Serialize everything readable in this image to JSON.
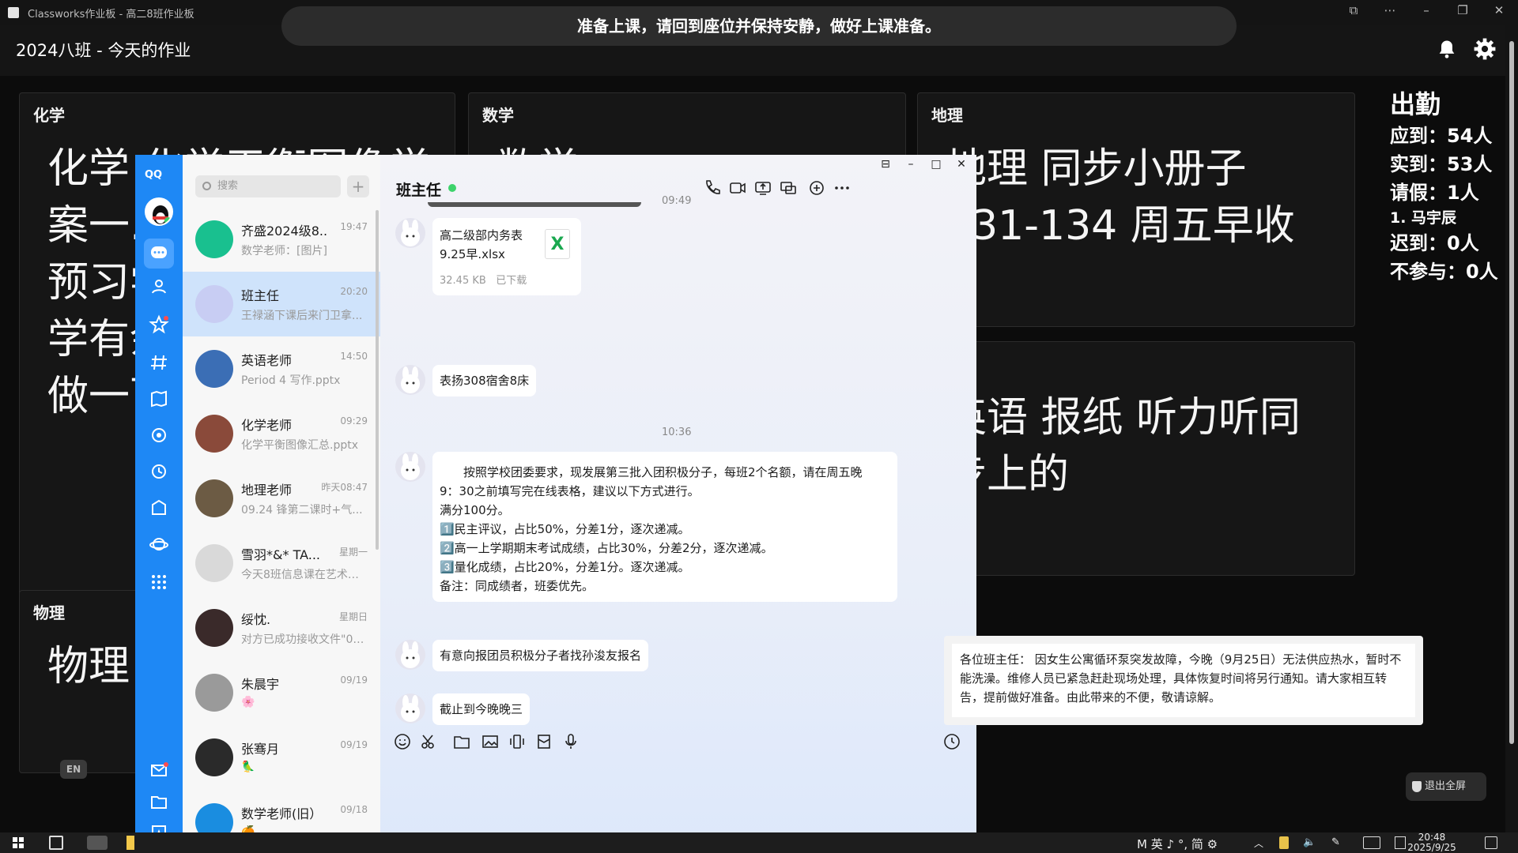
{
  "window": {
    "title": "Classworks作业板 - 高二8班作业板"
  },
  "banner": {
    "text": "准备上课，请回到座位并保持安静，做好上课准备。"
  },
  "header": {
    "title": "2024八班 - 今天的作业"
  },
  "cards": [
    {
      "subject": "化学",
      "lines": [
        "化学 化学平衡图像学",
        "案一...",
        "预习学",
        "学有余",
        "做一下"
      ]
    },
    {
      "subject": "数学",
      "lines": [
        "数学 ..."
      ]
    },
    {
      "subject": "地理",
      "lines": [
        "地理 同步小册子",
        "131-134 周五早收"
      ]
    },
    {
      "subject": "",
      "lines": [
        "英语 报纸 听力听同",
        "步上的"
      ]
    },
    {
      "subject": "物理",
      "lines": [
        "物理"
      ]
    }
  ],
  "attendance": {
    "title": "出勤",
    "due": "应到：54人",
    "present": "实到：53人",
    "leave": "请假：1人",
    "leave_name": "1. 马宇辰",
    "late": "迟到：0人",
    "absent": "不参与：0人"
  },
  "notice": {
    "text": "各位班主任： 因女生公寓循环泵突发故障，今晚（9月25日）无法供应热水，暂时不能洗澡。维修人员已紧急赶赴现场处理，具体恢复时间将另行通知。请大家相互转告，提前做好准备。由此带来的不便，敬请谅解。"
  },
  "exit_fullscreen": {
    "label": "退出全屏"
  },
  "en_badge": "EN",
  "qq": {
    "brand": "QQ",
    "search_placeholder": "搜索",
    "add": "+",
    "conversations": [
      {
        "name": "齐盛2024级8...",
        "time": "19:47",
        "preview": "数学老师：[图片]",
        "color": "#19c08f"
      },
      {
        "name": "班主任",
        "time": "20:20",
        "preview": "王禄涵下课后来门卫拿...",
        "color": "#c8cdf3"
      },
      {
        "name": "英语老师",
        "time": "14:50",
        "preview": "Period 4 写作.pptx",
        "color": "#3b6eb5"
      },
      {
        "name": "化学老师",
        "time": "09:29",
        "preview": "化学平衡图像汇总.pptx",
        "color": "#8a4a3a"
      },
      {
        "name": "地理老师",
        "time": "昨天08:47",
        "preview": "09.24 锋第二课时+气...",
        "color": "#6c5b44"
      },
      {
        "name": "雪羽*&* TA...",
        "time": "星期一",
        "preview": "今天8班信息课在艺术楼...",
        "color": "#d9d9d9"
      },
      {
        "name": "绥忱.",
        "time": "星期日",
        "preview": "对方已成功接收文件\"09...",
        "color": "#3a2a2a"
      },
      {
        "name": "朱晨宇",
        "time": "09/19",
        "preview": "🌸",
        "color": "#9a9a9a"
      },
      {
        "name": "张骞月",
        "time": "09/19",
        "preview": "🦜",
        "color": "#2a2a2a"
      },
      {
        "name": "数学老师(旧）",
        "time": "09/18",
        "preview": "🍊",
        "color": "#1a8de0"
      }
    ],
    "chat": {
      "title": "班主任",
      "time1": "09:49",
      "file": {
        "name": "高二级部内务表 9.25早.xlsx",
        "size": "32.45 KB",
        "status": "已下载",
        "badge": "X"
      },
      "msg1": "表扬308宿舍8床",
      "time2": "10:36",
      "long_msg": [
        "　　按照学校团委要求，现发展第三批入团积极分子，每班2个名额，请在周五晚",
        "9：30之前填写完在线表格，建议以下方式进行。",
        "满分100分。",
        "1️⃣民主评议，占比50%，分差1分，逐次递减。",
        "2️⃣高一上学期期末考试成绩，占比30%，分差2分，逐次递减。",
        "3️⃣量化成绩，占比20%，分差1分。逐次递减。",
        "备注：同成绩者，班委优先。"
      ],
      "msg2": "有意向报团员积极分子者找孙浚友报名",
      "msg3": "截止到今晚晚三"
    }
  },
  "taskbar": {
    "ime": "M 英 ♪ °, 简 ⚙",
    "time": "20:48",
    "date": "2025/9/25"
  }
}
